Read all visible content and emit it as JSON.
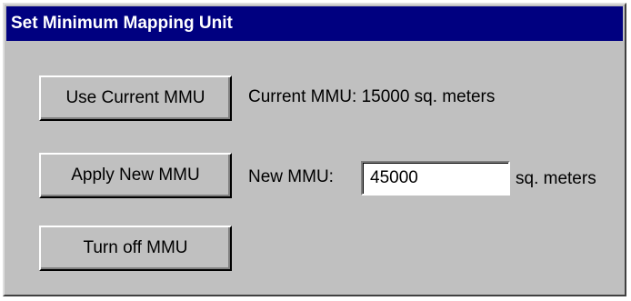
{
  "window": {
    "title": "Set Minimum Mapping Unit"
  },
  "buttons": {
    "use_current": "Use Current MMU",
    "apply_new": "Apply New MMU",
    "turn_off": "Turn off MMU"
  },
  "current_mmu": {
    "label": "Current MMU: 15000 sq. meters"
  },
  "new_mmu": {
    "label": "New MMU:",
    "value": "45000",
    "units": "sq. meters"
  },
  "colors": {
    "titlebar": "#000080",
    "dialog_bg": "#c0c0c0",
    "input_bg": "#ffffff"
  }
}
